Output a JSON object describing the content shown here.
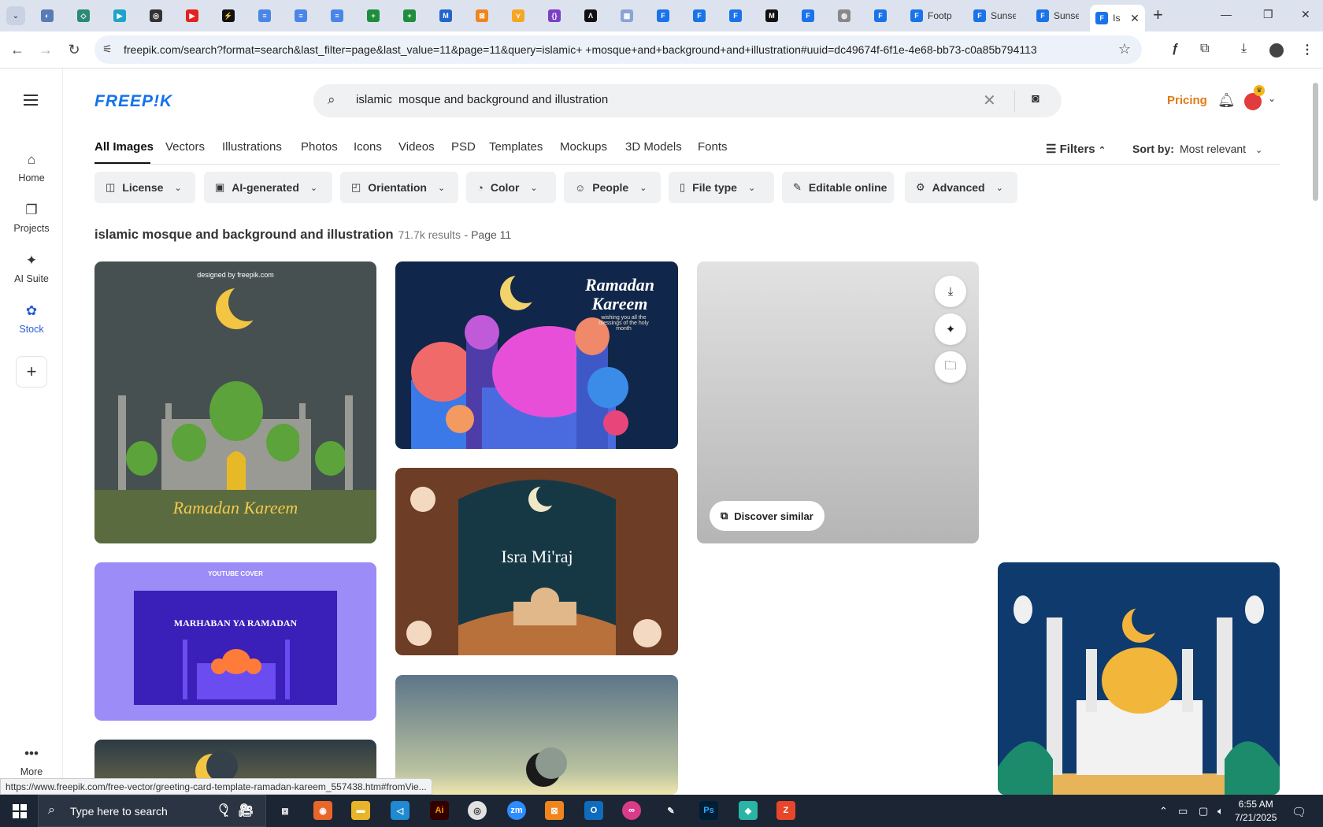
{
  "browser": {
    "tabs": [
      {
        "fav": "#5a7bb5",
        "glyph": "◐"
      },
      {
        "fav": "#2b8a74",
        "glyph": "◇"
      },
      {
        "fav": "#1fa3c8",
        "glyph": "▶"
      },
      {
        "fav": "#333",
        "glyph": "◎"
      },
      {
        "fav": "#e52020",
        "glyph": "▶"
      },
      {
        "fav": "#111",
        "glyph": "⚡"
      },
      {
        "fav": "#4a86e8",
        "glyph": "≡"
      },
      {
        "fav": "#4a86e8",
        "glyph": "≡"
      },
      {
        "fav": "#4a86e8",
        "glyph": "≡"
      },
      {
        "fav": "#1e8e3e",
        "glyph": "+"
      },
      {
        "fav": "#1e8e3e",
        "glyph": "+"
      },
      {
        "fav": "#2266cc",
        "glyph": "M"
      },
      {
        "fav": "#f0851e",
        "glyph": "⊠"
      },
      {
        "fav": "#f5a623",
        "glyph": "⋎"
      },
      {
        "fav": "#7b3fc4",
        "glyph": "{}"
      },
      {
        "fav": "#111",
        "glyph": "Λ"
      },
      {
        "fav": "#8aa4d8",
        "glyph": "▦"
      },
      {
        "fav": "#1a73e8",
        "glyph": "F"
      },
      {
        "fav": "#1a73e8",
        "glyph": "F"
      },
      {
        "fav": "#1a73e8",
        "glyph": "F"
      },
      {
        "fav": "#111",
        "glyph": "M"
      },
      {
        "fav": "#1a73e8",
        "glyph": "F"
      },
      {
        "fav": "#888",
        "glyph": "◍"
      },
      {
        "fav": "#1a73e8",
        "glyph": "F"
      }
    ],
    "titled_tabs": [
      {
        "title": "Footp"
      },
      {
        "title": "Sunse"
      },
      {
        "title": "Sunse"
      }
    ],
    "active_tab": {
      "title": "Is"
    },
    "url": "freepik.com/search?format=search&last_filter=page&last_value=11&page=11&query=islamic+ +mosque+and+background+and+illustration#uuid=dc49674f-6f1e-4e68-bb73-c0a85b794113",
    "status_url": "https://www.freepik.com/free-vector/greeting-card-template-ramadan-kareem_557438.htm#fromVie..."
  },
  "leftnav": {
    "items": [
      {
        "label": "Home",
        "icon": "⌂"
      },
      {
        "label": "Projects",
        "icon": "❐"
      },
      {
        "label": "AI Suite",
        "icon": "✦"
      },
      {
        "label": "Stock",
        "icon": "✿"
      }
    ],
    "more": "More"
  },
  "header": {
    "logo": "FREEP!K",
    "search_value": "islamic  mosque and background and illustration",
    "pricing": "Pricing"
  },
  "type_tabs": [
    "All Images",
    "Vectors",
    "Illustrations",
    "Photos",
    "Icons",
    "Videos",
    "PSD",
    "Templates",
    "Mockups",
    "3D Models",
    "Fonts"
  ],
  "filters_label": "Filters",
  "sort": {
    "label": "Sort by:",
    "value": "Most relevant"
  },
  "chips": [
    {
      "label": "License",
      "icon": "◫"
    },
    {
      "label": "AI-generated",
      "icon": "▣"
    },
    {
      "label": "Orientation",
      "icon": "◰"
    },
    {
      "label": "Color",
      "icon": "◔"
    },
    {
      "label": "People",
      "icon": "☺"
    },
    {
      "label": "File type",
      "icon": "▯"
    },
    {
      "label": "Editable online",
      "icon": "✎"
    },
    {
      "label": "Advanced",
      "icon": "⚙"
    }
  ],
  "results": {
    "query": "islamic mosque and background and illustration",
    "count": "71.7k results",
    "page": "- Page 11"
  },
  "cards": [
    {
      "title": "Ramadan Kareem",
      "sub": "designed by freepik.com",
      "bg": "#465051"
    },
    {
      "title": "Ramadan Kareem",
      "sub": "wishing you all the blessings of the holy month",
      "bg": "#10264a"
    },
    {
      "title": "",
      "sub": "",
      "bg": "#cfcfcf"
    },
    {
      "title": "MARHABAN YA RAMADAN",
      "sub": "YOUTUBE COVER",
      "bg": "#9c8cf7"
    },
    {
      "title": "Isra Mi'raj",
      "sub": "",
      "bg": "#163845"
    },
    {
      "title": "",
      "sub": "",
      "bg": "#0f3a6e"
    }
  ],
  "hover_card": {
    "discover": "Discover similar"
  },
  "taskbar": {
    "search_placeholder": "Type here to search",
    "time": "6:55 AM",
    "date": "7/21/2025"
  }
}
